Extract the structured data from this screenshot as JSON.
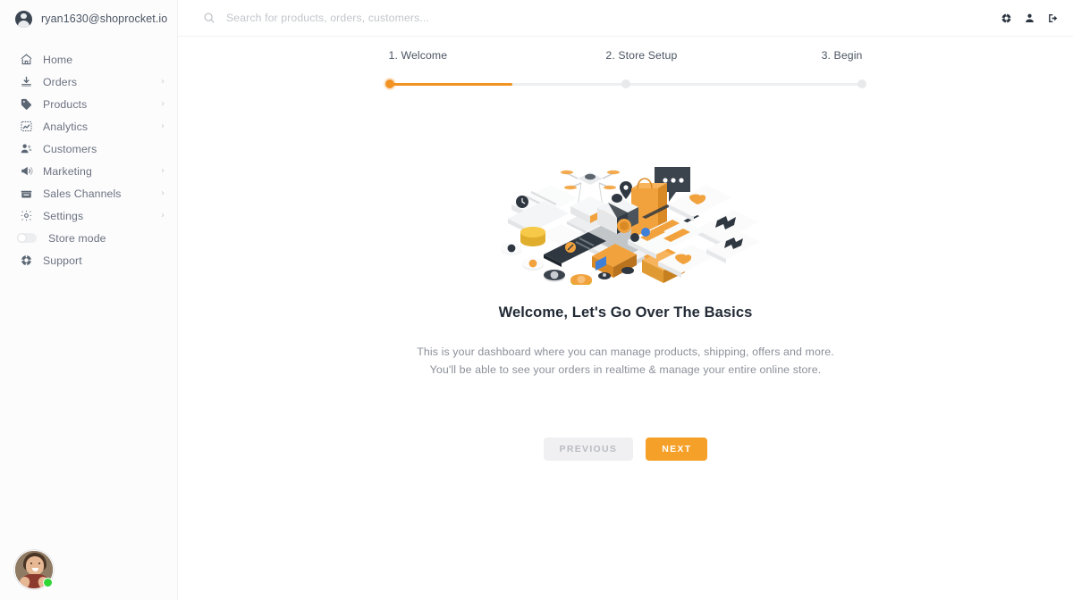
{
  "sidebar": {
    "account": {
      "email": "ryan1630@shoprocket.io",
      "avatar_icon": "user-circle-icon"
    },
    "items": [
      {
        "label": "Home",
        "icon": "home-icon",
        "chevron": false
      },
      {
        "label": "Orders",
        "icon": "inbox-download-icon",
        "chevron": true
      },
      {
        "label": "Products",
        "icon": "tag-icon",
        "chevron": true
      },
      {
        "label": "Analytics",
        "icon": "chart-line-icon",
        "chevron": true
      },
      {
        "label": "Customers",
        "icon": "users-icon",
        "chevron": false
      },
      {
        "label": "Marketing",
        "icon": "megaphone-icon",
        "chevron": true
      },
      {
        "label": "Sales Channels",
        "icon": "storefront-icon",
        "chevron": true
      },
      {
        "label": "Settings",
        "icon": "gear-icon",
        "chevron": true
      }
    ],
    "store_mode": {
      "label": "Store mode",
      "enabled": false,
      "icon": "toggle-off-icon"
    },
    "support": {
      "label": "Support",
      "icon": "lifebuoy-icon"
    },
    "user_avatar": {
      "icon": "avatar-photo",
      "status": "online",
      "status_color": "#2fd636"
    }
  },
  "topbar": {
    "search": {
      "placeholder": "Search for products, orders, customers...",
      "value": "",
      "icon": "search-icon"
    },
    "actions": [
      {
        "name": "help-icon",
        "glyph": "lifebuoy"
      },
      {
        "name": "account-icon",
        "glyph": "user"
      },
      {
        "name": "logout-icon",
        "glyph": "sign-out"
      }
    ]
  },
  "stepper": {
    "steps": [
      {
        "label": "1. Welcome",
        "state": "active"
      },
      {
        "label": "2. Store Setup",
        "state": "pending"
      },
      {
        "label": "3. Begin",
        "state": "pending"
      }
    ],
    "progress_percent": 26,
    "active_color": "#f29222",
    "track_color": "#eeeff1"
  },
  "hero": {
    "illustration": "ecommerce-isometric-illustration",
    "title": "Welcome, Let's Go Over The Basics",
    "body_line1": "This is your dashboard where you can manage products, shipping, offers and more.",
    "body_line2": "You'll be able to see your orders in realtime & manage your entire online store.",
    "previous_label": "PREVIOUS",
    "next_label": "NEXT",
    "next_color": "#f5a028",
    "previous_color": "#f0f0f2"
  }
}
